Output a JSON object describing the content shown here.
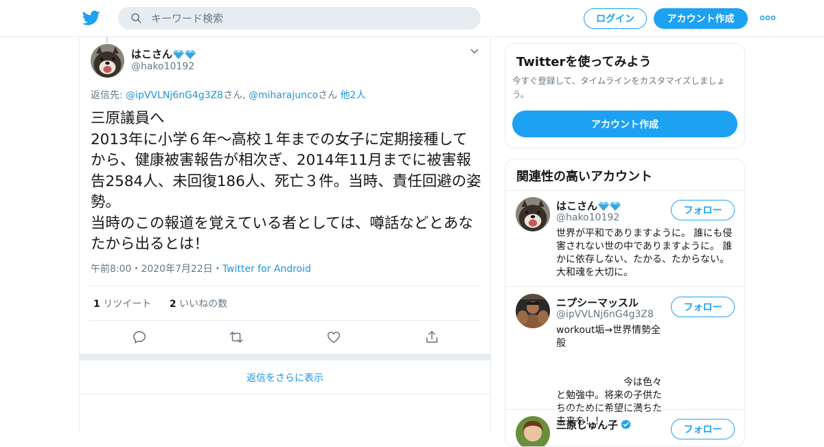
{
  "header": {
    "search_placeholder": "キーワード検索",
    "login_label": "ログイン",
    "signup_label": "アカウント作成"
  },
  "tweet": {
    "author_name": "はこさん",
    "author_handle": "@hako10192",
    "reply_prefix": "返信先: ",
    "reply_user1": "@ipVVLNj6nG4g3Z8",
    "reply_sep1": "さん, ",
    "reply_user2": "@miharajunco",
    "reply_sep2": "さん ",
    "reply_others": "他2人",
    "text": "三原議員へ\n2013年に小学６年～高校１年までの女子に定期接種してから、健康被害報告が相次ぎ、2014年11月までに被害報告2584人、未回復186人、死亡３件。当時、責任回避の姿勢。\n当時のこの報道を覚えている者としては、噂話などとあなたから出るとは！",
    "time": "午前8:00",
    "sep": "・",
    "date": "2020年7月22日",
    "client": "Twitter for Android",
    "retweet_count": "1",
    "retweet_label": "リツイート",
    "like_count": "2",
    "like_label": "いいねの数",
    "show_more_replies": "返信をさらに表示"
  },
  "sidebar": {
    "try_title": "Twitterを使ってみよう",
    "try_desc": "今すぐ登録して、タイムラインをカスタマイズしましょう。",
    "try_cta": "アカウント作成",
    "related_title": "関連性の高いアカウント",
    "follow_label": "フォロー",
    "accounts": [
      {
        "name": "はこさん",
        "handle": "@hako10192",
        "bio": "世界が平和でありますように。 誰にも侵害されない世の中でありますように。 誰かに依存しない、たかる、たからない。 大和魂を大切に。"
      },
      {
        "name": "ニプシーマッスル",
        "handle": "@ipVVLNj6nG4g3Z8",
        "bio": "workout垢→世界情勢全般\n\n\n                      今は色々と勉強中。将来の子供たちのために希望に満ちた未来を！！"
      },
      {
        "name": "三原じゅん子",
        "handle": "",
        "bio": ""
      }
    ]
  },
  "colors": {
    "brand": "#1da1f2",
    "link": "#1b95e0",
    "muted": "#657786",
    "border": "#e6ecf0"
  }
}
